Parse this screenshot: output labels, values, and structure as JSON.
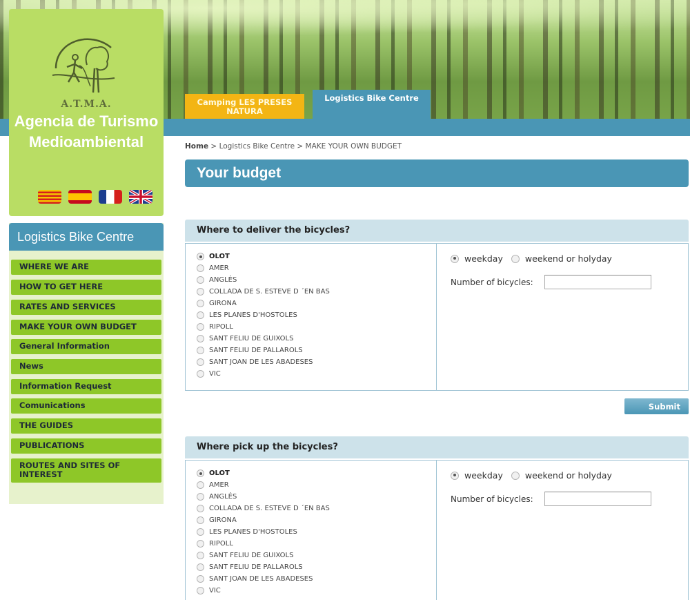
{
  "header": {
    "tabs": [
      {
        "label": "Camping LES PRESES NATURA",
        "color": "#f3b514"
      },
      {
        "label": "Logistics Bike Centre",
        "color": "#4a96b5",
        "active": true
      }
    ]
  },
  "logo": {
    "acronym": "A.T.M.A.",
    "name": "Agencia de Turismo Medioambiental",
    "flags": [
      "catalan-flag-icon",
      "spanish-flag-icon",
      "french-flag-icon",
      "uk-flag-icon"
    ]
  },
  "sidebar": {
    "title": "Logistics Bike Centre",
    "items": [
      {
        "label": "WHERE WE ARE"
      },
      {
        "label": "HOW TO GET HERE"
      },
      {
        "label": "RATES AND SERVICES"
      },
      {
        "label": "MAKE YOUR OWN BUDGET"
      },
      {
        "label": "General Information"
      },
      {
        "label": "News"
      },
      {
        "label": "Information Request"
      },
      {
        "label": "Comunications"
      },
      {
        "label": "THE GUIDES"
      },
      {
        "label": "PUBLICATIONS"
      },
      {
        "label": "ROUTES AND SITES OF INTEREST"
      }
    ]
  },
  "breadcrumb": {
    "home": "Home",
    "sep1": " > ",
    "section": "Logistics Bike Centre",
    "sep2": " > ",
    "current": "MAKE YOUR OWN BUDGET"
  },
  "page": {
    "title": "Your budget"
  },
  "locations": [
    "OLOT",
    "AMER",
    "ANGLÉS",
    "COLLADA DE S. ESTEVE D ´EN BAS",
    "GIRONA",
    "LES PLANES D'HOSTOLES",
    "RIPOLL",
    "SANT FELIU DE GUIXOLS",
    "SANT FELIU DE PALLAROLS",
    "SANT JOAN DE LES ABADESES",
    "VIC"
  ],
  "deliver": {
    "heading": "Where to deliver the bicycles?",
    "selected_location": "OLOT",
    "day_options": [
      "weekday",
      "weekend or holyday"
    ],
    "selected_day": "weekday",
    "qty_label": "Number of bicycles:",
    "qty_value": ""
  },
  "pickup": {
    "heading": "Where pick up the bicycles?",
    "selected_location": "OLOT",
    "day_options": [
      "weekday",
      "weekend or holyday"
    ],
    "selected_day": "weekday",
    "qty_label": "Number of bicycles:",
    "qty_value": ""
  },
  "submit_label": "Submit",
  "colors": {
    "accent_blue": "#4a96b5",
    "nav_green": "#8ec728",
    "logo_green": "#b9dd64",
    "tab_yellow": "#f3b514"
  }
}
